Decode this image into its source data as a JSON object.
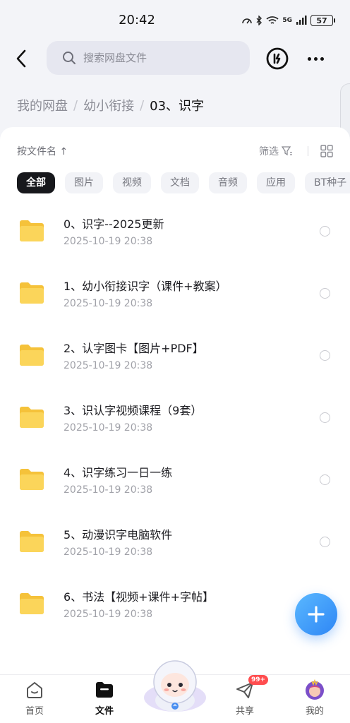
{
  "status": {
    "time": "20:42",
    "network": "5G",
    "battery": "57"
  },
  "search": {
    "placeholder": "搜索网盘文件"
  },
  "breadcrumb": {
    "items": [
      "我的网盘",
      "幼小衔接"
    ],
    "current": "03、识字"
  },
  "toolbar": {
    "sort_label": "按文件名",
    "filter_label": "筛选"
  },
  "chips": [
    "全部",
    "图片",
    "视频",
    "文档",
    "音频",
    "应用",
    "BT种子"
  ],
  "files": [
    {
      "name": "0、识字--2025更新",
      "time": "2025-10-19  20:38"
    },
    {
      "name": "1、幼小衔接识字（课件+教案）",
      "time": "2025-10-19  20:38"
    },
    {
      "name": "2、认字图卡【图片+PDF】",
      "time": "2025-10-19  20:38"
    },
    {
      "name": "3、识认字视频课程（9套）",
      "time": "2025-10-19  20:38"
    },
    {
      "name": "4、识字练习一日一练",
      "time": "2025-10-19  20:38"
    },
    {
      "name": "5、动漫识字电脑软件",
      "time": "2025-10-19  20:38"
    },
    {
      "name": "6、书法【视频+课件+字帖】",
      "time": "2025-10-19  20:38"
    }
  ],
  "nav": {
    "home": "首页",
    "files": "文件",
    "share": "共享",
    "share_badge": "99+",
    "mine": "我的"
  },
  "colors": {
    "accent": "#2e86f5",
    "folder": "#f9cf4d",
    "badge": "#ff4d4f"
  }
}
